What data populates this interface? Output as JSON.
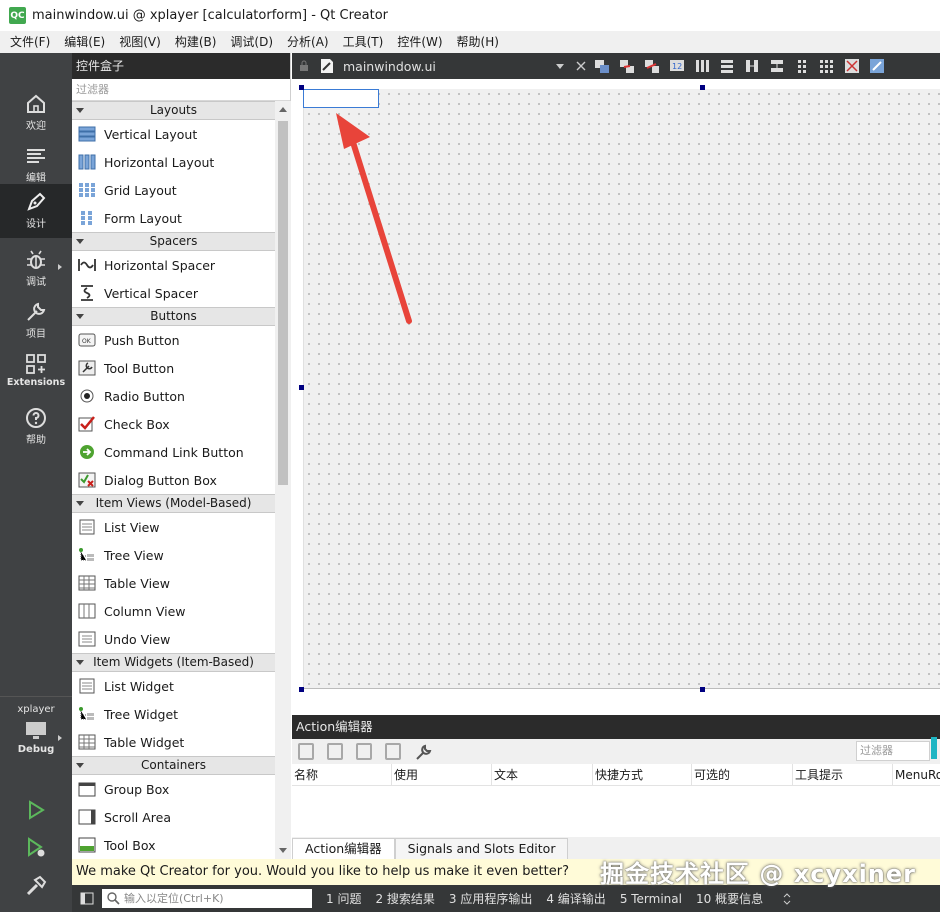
{
  "window": {
    "logo": "QC",
    "title": "mainwindow.ui @ xplayer [calculatorform] - Qt Creator"
  },
  "menubar": [
    "文件(F)",
    "编辑(E)",
    "视图(V)",
    "构建(B)",
    "调试(D)",
    "分析(A)",
    "工具(T)",
    "控件(W)",
    "帮助(H)"
  ],
  "modes": [
    {
      "label": "欢迎",
      "icon": "home-icon"
    },
    {
      "label": "编辑",
      "icon": "edit-lines-icon"
    },
    {
      "label": "设计",
      "icon": "pen-icon"
    },
    {
      "label": "调试",
      "icon": "bug-icon"
    },
    {
      "label": "项目",
      "icon": "wrench-icon"
    },
    {
      "label": "Extensions",
      "icon": "extensions-icon"
    },
    {
      "label": "帮助",
      "icon": "help-icon"
    }
  ],
  "kit": {
    "project": "xplayer",
    "config": "Debug"
  },
  "widgetbox": {
    "title": "控件盒子",
    "filter_placeholder": "过滤器",
    "sections": [
      {
        "title": "Layouts",
        "items": [
          "Vertical Layout",
          "Horizontal Layout",
          "Grid Layout",
          "Form Layout"
        ]
      },
      {
        "title": "Spacers",
        "items": [
          "Horizontal Spacer",
          "Vertical Spacer"
        ]
      },
      {
        "title": "Buttons",
        "items": [
          "Push Button",
          "Tool Button",
          "Radio Button",
          "Check Box",
          "Command Link Button",
          "Dialog Button Box"
        ]
      },
      {
        "title": "Item Views (Model-Based)",
        "items": [
          "List View",
          "Tree View",
          "Table View",
          "Column View",
          "Undo View"
        ]
      },
      {
        "title": "Item Widgets (Item-Based)",
        "items": [
          "List Widget",
          "Tree Widget",
          "Table Widget"
        ]
      },
      {
        "title": "Containers",
        "items": [
          "Group Box",
          "Scroll Area",
          "Tool Box"
        ]
      }
    ]
  },
  "editor": {
    "file_tab": "mainwindow.ui"
  },
  "action_editor": {
    "title": "Action编辑器",
    "filter_placeholder": "过滤器",
    "columns": [
      "名称",
      "使用",
      "文本",
      "快捷方式",
      "可选的",
      "工具提示",
      "MenuRole"
    ],
    "tabs": [
      "Action编辑器",
      "Signals and Slots Editor"
    ]
  },
  "info_bar": {
    "text": "We make Qt Creator for you. Would you like to help us make it even better?"
  },
  "status_bar": {
    "locator_placeholder": "输入以定位(Ctrl+K)",
    "output_tabs": [
      "1  问题",
      "2  搜索结果",
      "3  应用程序输出",
      "4  编译输出",
      "5  Terminal",
      "10  概要信息"
    ]
  },
  "watermark": "掘金技术社区 @ xcyxiner",
  "colors": {
    "accent_arrow": "#e8443a",
    "mode_bar": "#404244",
    "dark_panel": "#2b2b2b",
    "selection": "#3a7bd5"
  }
}
